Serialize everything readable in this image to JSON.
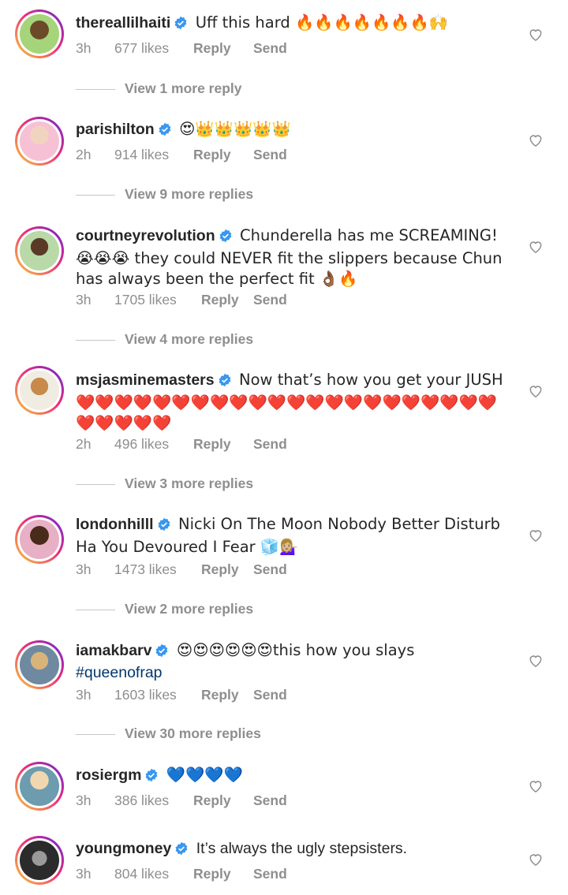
{
  "comments": [
    {
      "username": "thereallilhaiti",
      "text": "Uff this hard 🔥🔥🔥🔥🔥🔥🔥🙌",
      "time": "3h",
      "likes": "677 likes",
      "reply": "Reply",
      "send": "Send",
      "view_more": "View 1 more reply"
    },
    {
      "username": "parishilton",
      "text": "😍👑👑👑👑👑",
      "time": "2h",
      "likes": "914 likes",
      "reply": "Reply",
      "send": "Send",
      "view_more": "View 9 more replies"
    },
    {
      "username": "courtneyrevolution",
      "text": "Chunderella has me SCREAMING! 😭😭😭 they could NEVER fit the slippers because Chun has always been the perfect fit 👌🏾🔥",
      "time": "3h",
      "likes": "1705 likes",
      "reply": "Reply",
      "send": "Send",
      "view_more": "View 4 more replies"
    },
    {
      "username": "msjasminemasters",
      "text": "Now that’s how you get your JUSH❤️❤️❤️❤️❤️❤️❤️❤️❤️❤️❤️❤️❤️❤️❤️❤️❤️❤️❤️❤️❤️❤️❤️❤️❤️❤️❤️",
      "time": "2h",
      "likes": "496 likes",
      "reply": "Reply",
      "send": "Send",
      "view_more": "View 3 more replies"
    },
    {
      "username": "londonhilll",
      "text": "Nicki On The Moon Nobody Better Disturb Ha You Devoured I Fear 🧊💁🏼‍♀️",
      "time": "3h",
      "likes": "1473 likes",
      "reply": "Reply",
      "send": "Send",
      "view_more": "View 2 more replies"
    },
    {
      "username": "iamakbarv",
      "text": "😍😍😍😍😍😍this how you slays",
      "hashtag": "#queenofrap",
      "time": "3h",
      "likes": "1603 likes",
      "reply": "Reply",
      "send": "Send",
      "view_more": "View 30 more replies"
    },
    {
      "username": "rosiergm",
      "text": "💙💙💙💙",
      "time": "3h",
      "likes": "386 likes",
      "reply": "Reply",
      "send": "Send"
    },
    {
      "username": "youngmoney",
      "text": "It’s always the ugly stepsisters.",
      "time": "3h",
      "likes": "804 likes",
      "reply": "Reply",
      "send": "Send"
    }
  ],
  "colors": {
    "verified": "#3897f0",
    "muted": "#8e8e8e",
    "text": "#262626",
    "hashtag": "#00376b"
  }
}
